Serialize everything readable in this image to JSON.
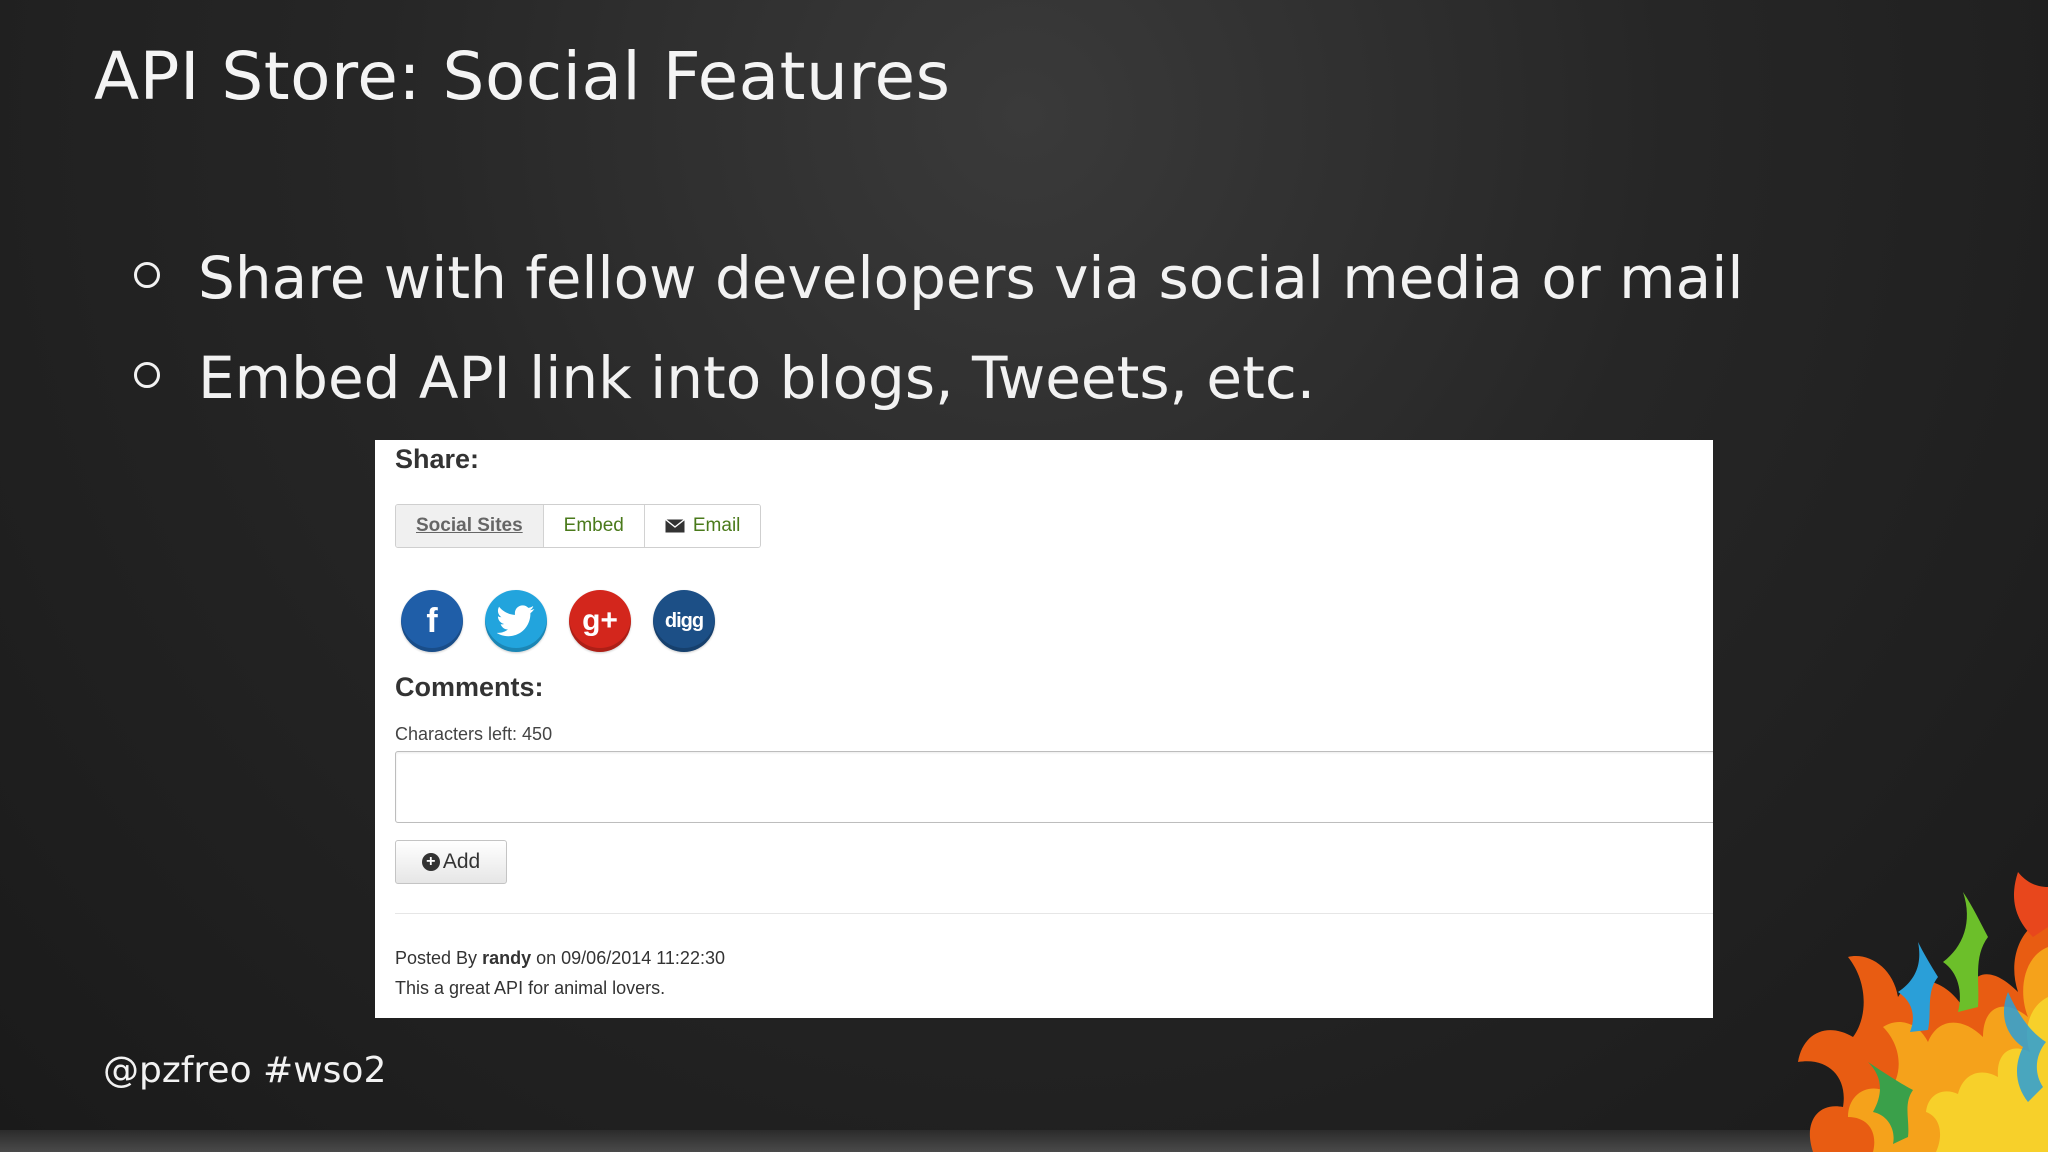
{
  "slide": {
    "title": "API Store: Social Features",
    "bullets": [
      "Share with fellow developers via social media or mail",
      "Embed API link into blogs, Tweets, etc."
    ],
    "footer_handle": "@pzfreo #wso2"
  },
  "share_panel": {
    "heading": "Share:",
    "tabs": [
      "Social Sites",
      "Embed",
      "Email"
    ],
    "active_tab": "Social Sites",
    "social_icons": [
      {
        "name": "facebook",
        "glyph": "f"
      },
      {
        "name": "twitter",
        "glyph": ""
      },
      {
        "name": "google-plus",
        "glyph": "g+"
      },
      {
        "name": "digg",
        "glyph": "digg"
      }
    ]
  },
  "comments_panel": {
    "heading": "Comments:",
    "chars_left": "Characters left: 450",
    "input_value": "",
    "add_label": "Add",
    "post": {
      "prefix": "Posted By",
      "author": "randy",
      "on": "on",
      "timestamp": "09/06/2014 11:22:30",
      "text": "This a great API for animal lovers."
    }
  },
  "colors": {
    "background": "#262626",
    "link_green": "#4a7a1b",
    "facebook": "#1f5ea8",
    "twitter": "#22a4dd",
    "google_plus": "#d3261c",
    "digg": "#1c4f86"
  }
}
